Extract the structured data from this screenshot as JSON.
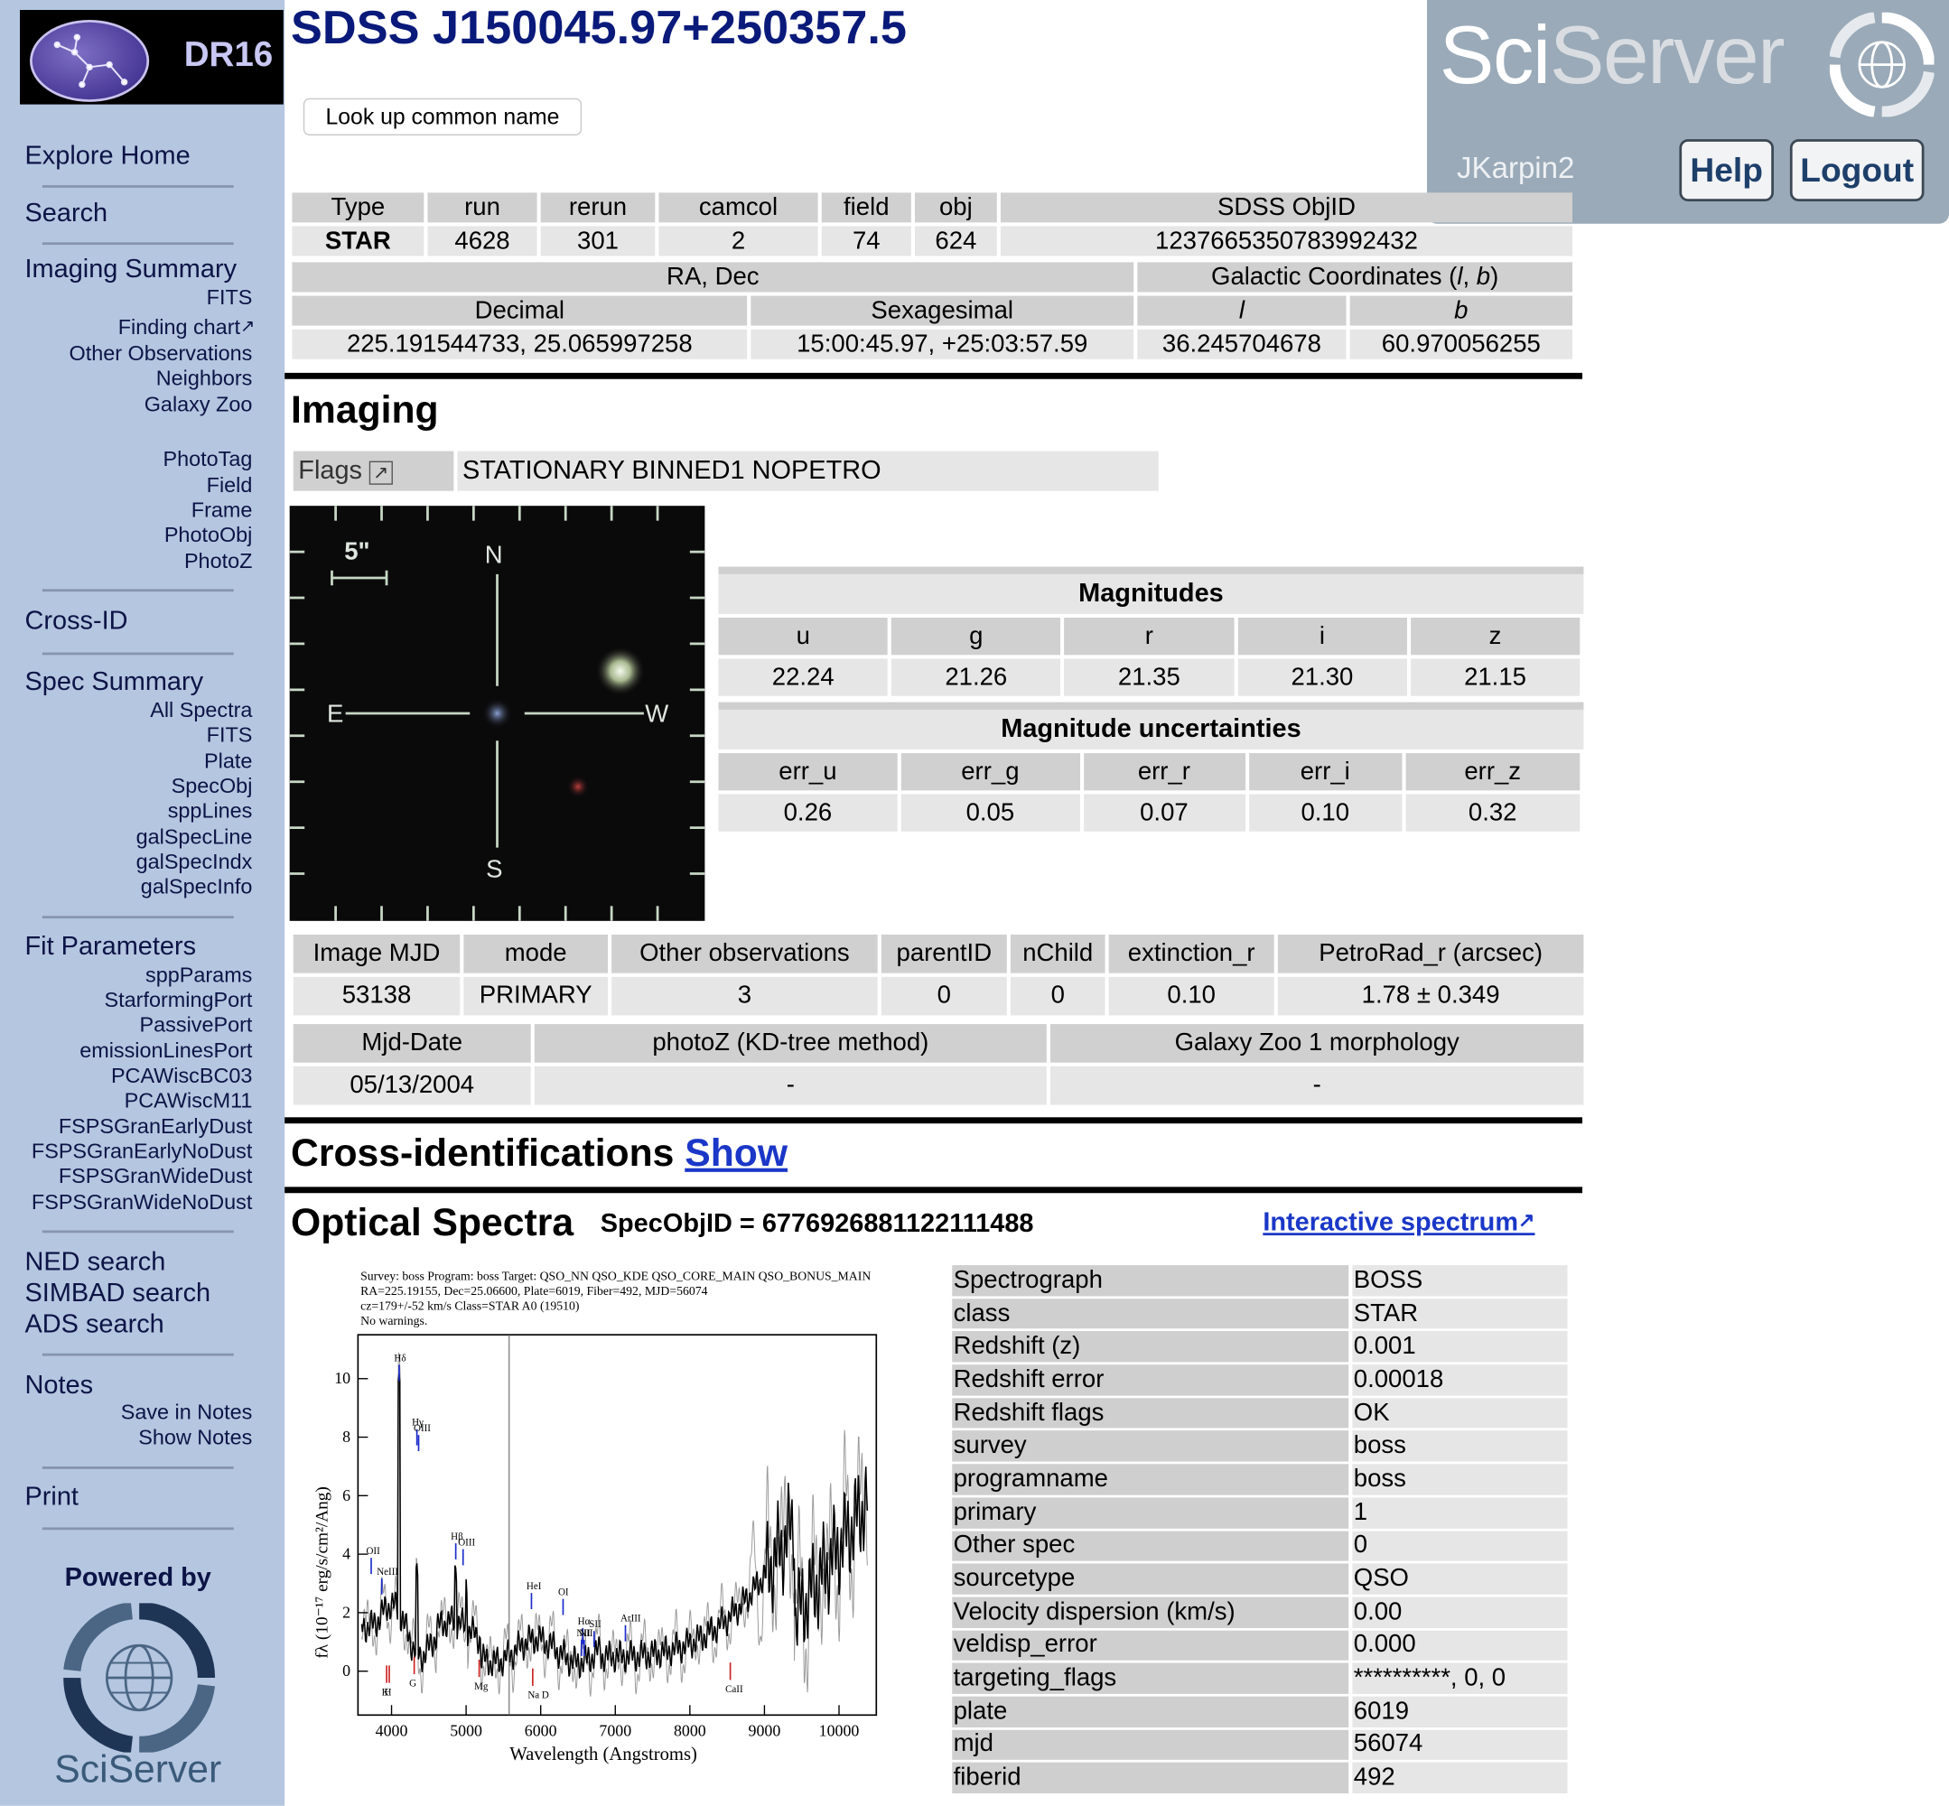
{
  "sidebar": {
    "logo_text": "DR16",
    "explore_home": "Explore Home",
    "search": "Search",
    "imaging_summary": "Imaging Summary",
    "imaging_links": [
      "FITS",
      "Finding chart",
      "Other Observations",
      "Neighbors",
      "Galaxy Zoo"
    ],
    "photo_links": [
      "PhotoTag",
      "Field",
      "Frame",
      "PhotoObj",
      "PhotoZ"
    ],
    "cross_id": "Cross-ID",
    "spec_summary": "Spec Summary",
    "spec_links": [
      "All Spectra",
      "FITS",
      "Plate",
      "SpecObj",
      "sppLines",
      "galSpecLine",
      "galSpecIndx",
      "galSpecInfo"
    ],
    "fit_parameters": "Fit Parameters",
    "fit_links": [
      "sppParams",
      "StarformingPort",
      "PassivePort",
      "emissionLinesPort",
      "PCAWiscBC03",
      "PCAWiscM11",
      "FSPSGranEarlyDust",
      "FSPSGranEarlyNoDust",
      "FSPSGranWideDust",
      "FSPSGranWideNoDust"
    ],
    "external": [
      "NED search",
      "SIMBAD search",
      "ADS search"
    ],
    "notes": "Notes",
    "notes_links": [
      "Save in Notes",
      "Show Notes"
    ],
    "print": "Print",
    "powered_by": "Powered by",
    "sciserver_text": "SciServer"
  },
  "header": {
    "title": "SDSS J150045.97+250357.5",
    "lookup_button": "Look up common name"
  },
  "sciserver": {
    "logo_sci": "Sci",
    "logo_server": "Server",
    "user": "JKarpin2",
    "help": "Help",
    "logout": "Logout"
  },
  "summary": {
    "headers": [
      "Type",
      "run",
      "rerun",
      "camcol",
      "field",
      "obj",
      "SDSS ObjID"
    ],
    "values": [
      "STAR",
      "4628",
      "301",
      "2",
      "74",
      "624",
      "1237665350783992432"
    ],
    "radec_label": "RA, Dec",
    "galactic_label": "Galactic Coordinates (",
    "galactic_l": "l",
    "galactic_b": "b",
    "decimal_label": "Decimal",
    "sexagesimal_label": "Sexagesimal",
    "l_label": "l",
    "b_label": "b",
    "decimal": "225.191544733, 25.065997258",
    "sexagesimal": "15:00:45.97, +25:03:57.59",
    "l_value": "36.245704678",
    "b_value": "60.970056255"
  },
  "imaging": {
    "heading": "Imaging",
    "flags_label": "Flags",
    "flags_value": "STATIONARY BINNED1 NOPETRO",
    "cutout": {
      "scale": "5\"",
      "n": "N",
      "s": "S",
      "e": "E",
      "w": "W"
    },
    "magnitudes_title": "Magnitudes",
    "mag_bands": [
      "u",
      "g",
      "r",
      "i",
      "z"
    ],
    "mag_values": [
      "22.24",
      "21.26",
      "21.35",
      "21.30",
      "21.15"
    ],
    "err_title": "Magnitude uncertainties",
    "err_bands": [
      "err_u",
      "err_g",
      "err_r",
      "err_i",
      "err_z"
    ],
    "err_values": [
      "0.26",
      "0.05",
      "0.07",
      "0.10",
      "0.32"
    ],
    "props_headers": [
      "Image MJD",
      "mode",
      "Other observations",
      "parentID",
      "nChild",
      "extinction_r",
      "PetroRad_r (arcsec)"
    ],
    "props_values": [
      "53138",
      "PRIMARY",
      "3",
      "0",
      "0",
      "0.10",
      "1.78 ± 0.349"
    ],
    "extra_headers": [
      "Mjd-Date",
      "photoZ (KD-tree method)",
      "Galaxy Zoo 1 morphology"
    ],
    "extra_values": [
      "05/13/2004",
      "-",
      "-"
    ]
  },
  "crossid": {
    "heading": "Cross-identifications",
    "show_link": "Show"
  },
  "spectra": {
    "heading": "Optical Spectra",
    "specobjid": "SpecObjID = 6776926881122111488",
    "interactive_link": "Interactive spectrum",
    "plot": {
      "header_line1": "Survey: boss  Program: boss  Target: QSO_NN QSO_KDE QSO_CORE_MAIN QSO_BONUS_MAIN",
      "header_line2": "RA=225.19155, Dec=25.06600, Plate=6019, Fiber=492, MJD=56074",
      "header_line3": "cz=179+/-52 km/s  Class=STAR A0 (19510)",
      "header_line4": "No warnings.",
      "xlabel": "Wavelength (Angstroms)",
      "ylabel": "fλ (10⁻¹⁷ erg/s/cm²/Ang)",
      "xticks": [
        "4000",
        "5000",
        "6000",
        "7000",
        "8000",
        "9000",
        "10000"
      ],
      "yticks": [
        "0",
        "2",
        "4",
        "6",
        "8",
        "10"
      ],
      "blue_lines": [
        "Hδ",
        "Hγ",
        "OIII",
        "Hβ",
        "OIII",
        "OII",
        "NeIII",
        "HeI",
        "OI",
        "Hα",
        "SII",
        "NII",
        "NII",
        "ArIII"
      ],
      "red_lines": [
        "K",
        "H",
        "G",
        "Mg",
        "Na D",
        "CaII"
      ]
    },
    "properties": [
      [
        "Spectrograph",
        "BOSS"
      ],
      [
        "class",
        "STAR"
      ],
      [
        "Redshift (z)",
        "0.001"
      ],
      [
        "Redshift error",
        "0.00018"
      ],
      [
        "Redshift flags",
        "OK"
      ],
      [
        "survey",
        "boss"
      ],
      [
        "programname",
        "boss"
      ],
      [
        "primary",
        "1"
      ],
      [
        "Other spec",
        "0"
      ],
      [
        "sourcetype",
        "QSO"
      ],
      [
        "Velocity dispersion (km/s)",
        "0.00"
      ],
      [
        "veldisp_error",
        "0.000"
      ],
      [
        "targeting_flags",
        "**********, 0, 0"
      ],
      [
        "plate",
        "6019"
      ],
      [
        "mjd",
        "56074"
      ],
      [
        "fiberid",
        "492"
      ]
    ]
  },
  "colors": {
    "sidebar_bg": "#b5c6e0",
    "title_blue": "#0a1a7a",
    "link_blue": "#1a37c8",
    "sciserver_panel": "#9aaab8",
    "table_header": "#d0d0d0",
    "table_cell": "#e6e6e6"
  }
}
